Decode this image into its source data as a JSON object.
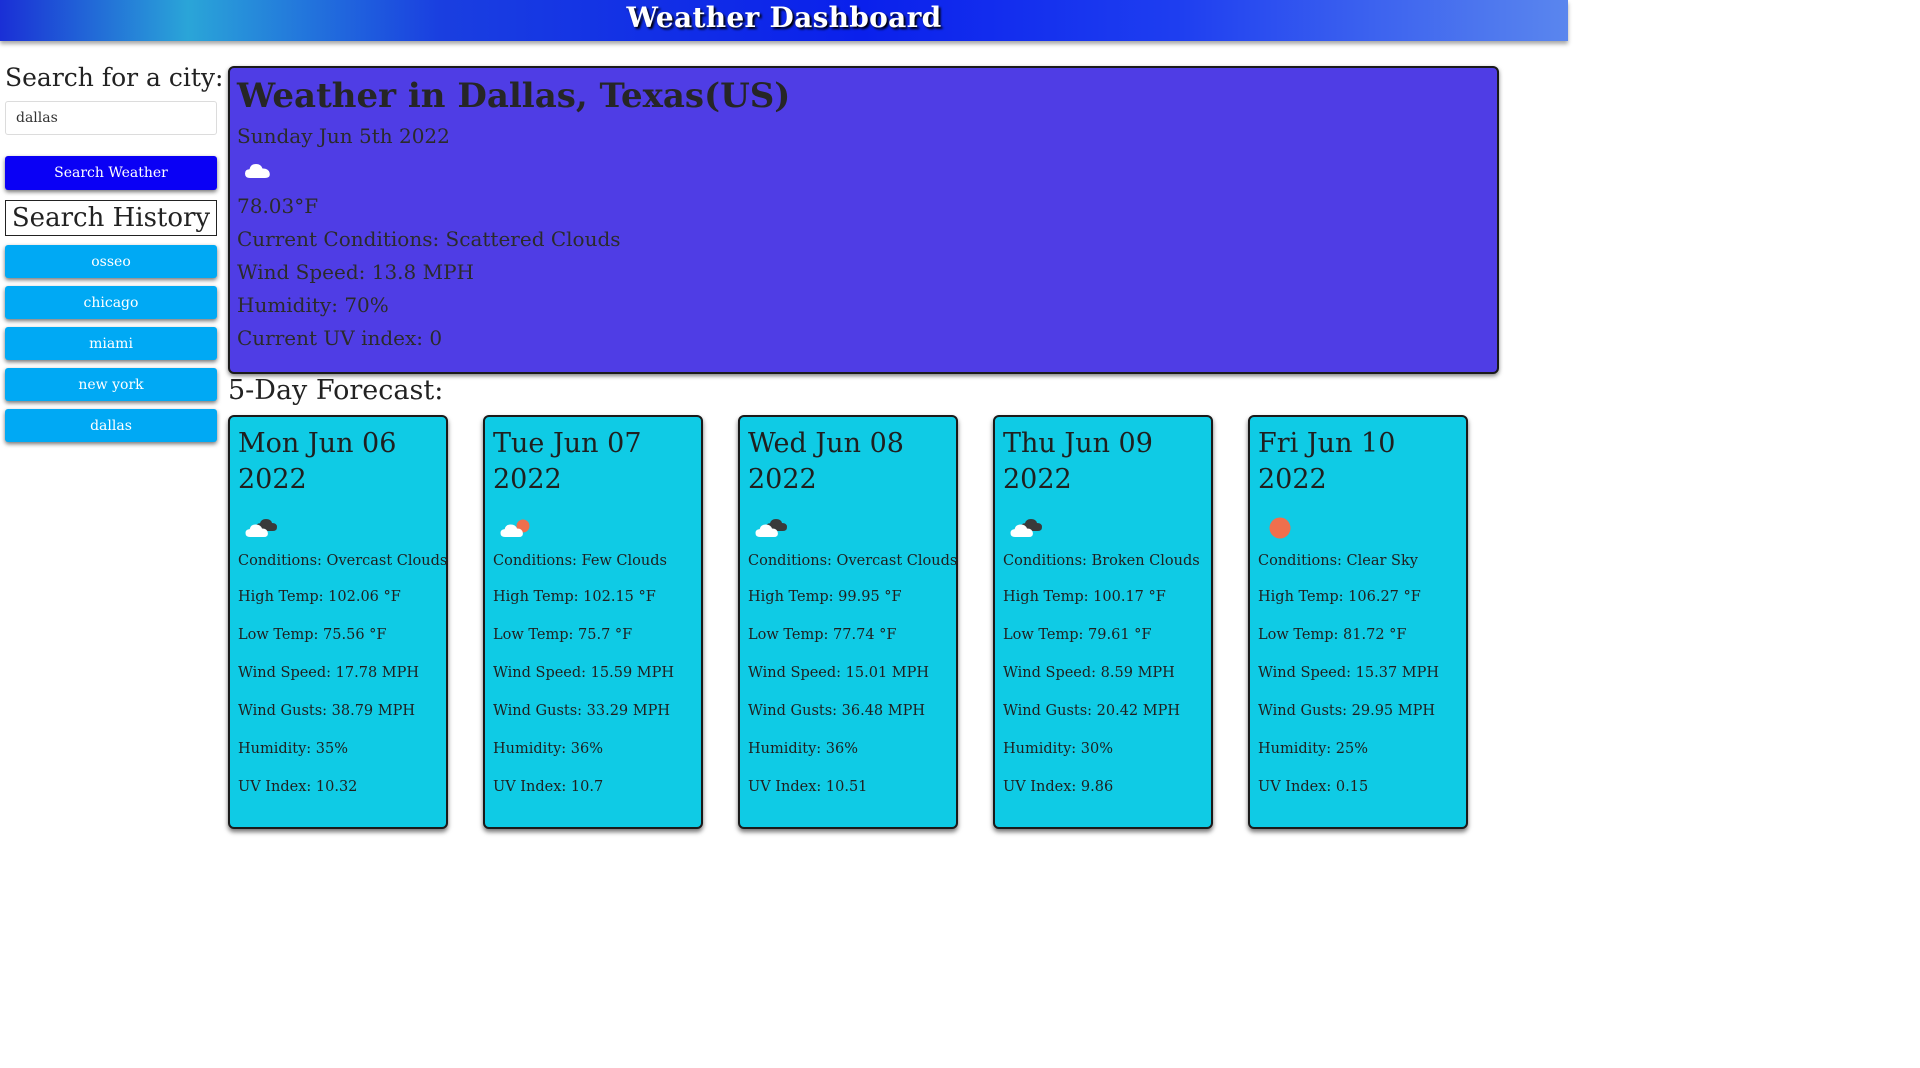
{
  "header": {
    "title": "Weather Dashboard"
  },
  "sidebar": {
    "search_label": "Search for a city:",
    "search_value": "dallas",
    "search_button": "Search Weather",
    "history_title": "Search History",
    "history": [
      "osseo",
      "chicago",
      "miami",
      "new york",
      "dallas"
    ]
  },
  "current": {
    "city": "Weather in Dallas, Texas(US)",
    "date": "Sunday Jun 5th 2022",
    "icon": "cloud-icon",
    "temp": "78.03°F",
    "conditions": "Current Conditions: Scattered Clouds",
    "wind": "Wind Speed: 13.8 MPH",
    "humidity": "Humidity: 70%",
    "uv": "Current UV index: 0"
  },
  "forecast": {
    "title": "5-Day Forecast:",
    "days": [
      {
        "date": "Mon Jun 06 2022",
        "icon": "overcast-clouds-icon",
        "conditions": "Conditions: Overcast Clouds",
        "high": "High Temp: 102.06 °F",
        "low": "Low Temp: 75.56 °F",
        "wind": "Wind Speed: 17.78 MPH",
        "gusts": "Wind Gusts: 38.79 MPH",
        "humidity": "Humidity: 35%",
        "uv": "UV Index: 10.32"
      },
      {
        "date": "Tue Jun 07 2022",
        "icon": "few-clouds-icon",
        "conditions": "Conditions: Few Clouds",
        "high": "High Temp: 102.15 °F",
        "low": "Low Temp: 75.7 °F",
        "wind": "Wind Speed: 15.59 MPH",
        "gusts": "Wind Gusts: 33.29 MPH",
        "humidity": "Humidity: 36%",
        "uv": "UV Index: 10.7"
      },
      {
        "date": "Wed Jun 08 2022",
        "icon": "overcast-clouds-icon",
        "conditions": "Conditions: Overcast Clouds",
        "high": "High Temp: 99.95 °F",
        "low": "Low Temp: 77.74 °F",
        "wind": "Wind Speed: 15.01 MPH",
        "gusts": "Wind Gusts: 36.48 MPH",
        "humidity": "Humidity: 36%",
        "uv": "UV Index: 10.51"
      },
      {
        "date": "Thu Jun 09 2022",
        "icon": "broken-clouds-icon",
        "conditions": "Conditions: Broken Clouds",
        "high": "High Temp: 100.17 °F",
        "low": "Low Temp: 79.61 °F",
        "wind": "Wind Speed: 8.59 MPH",
        "gusts": "Wind Gusts: 20.42 MPH",
        "humidity": "Humidity: 30%",
        "uv": "UV Index: 9.86"
      },
      {
        "date": "Fri Jun 10 2022",
        "icon": "clear-sky-sun-icon",
        "conditions": "Conditions: Clear Sky",
        "high": "High Temp: 106.27 °F",
        "low": "Low Temp: 81.72 °F",
        "wind": "Wind Speed: 15.37 MPH",
        "gusts": "Wind Gusts: 29.95 MPH",
        "humidity": "Humidity: 25%",
        "uv": "UV Index: 0.15"
      }
    ]
  },
  "colors": {
    "header_gradient": [
      "#1a2fd6",
      "#2aa5d8",
      "#0a20ec",
      "#5a86ee"
    ],
    "search_button": "#0a00f5",
    "history_button": "#00a9f4",
    "current_panel": "#4f3de5",
    "forecast_card": "#0fcbe5",
    "sun": "#ef6f4d"
  }
}
